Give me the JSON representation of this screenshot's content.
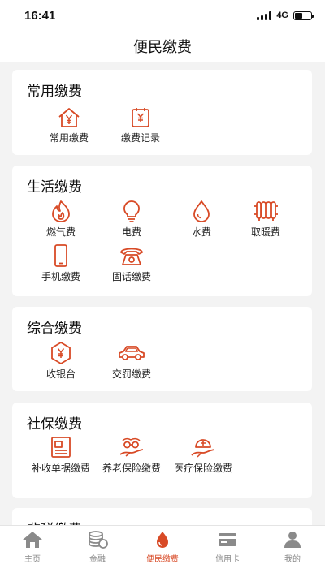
{
  "status_bar": {
    "time": "16:41",
    "network": "4G"
  },
  "header": {
    "title": "便民缴费"
  },
  "sections": [
    {
      "title": "常用缴费",
      "items": [
        {
          "label": "常用缴费",
          "icon": "house-yen-icon"
        },
        {
          "label": "缴费记录",
          "icon": "bill-record-icon"
        }
      ]
    },
    {
      "title": "生活缴费",
      "items": [
        {
          "label": "燃气费",
          "icon": "flame-icon"
        },
        {
          "label": "电费",
          "icon": "light-bulb-icon"
        },
        {
          "label": "水费",
          "icon": "water-drop-icon"
        },
        {
          "label": "取暖费",
          "icon": "radiator-icon"
        },
        {
          "label": "手机缴费",
          "icon": "mobile-phone-icon"
        },
        {
          "label": "固话缴费",
          "icon": "telephone-icon"
        }
      ]
    },
    {
      "title": "综合缴费",
      "items": [
        {
          "label": "收银台",
          "icon": "cashier-yen-icon"
        },
        {
          "label": "交罚缴费",
          "icon": "car-icon"
        }
      ]
    },
    {
      "title": "社保缴费",
      "items": [
        {
          "label": "补收单据缴费",
          "icon": "document-form-icon"
        },
        {
          "label": "养老保险缴费",
          "icon": "elderly-care-icon"
        },
        {
          "label": "医疗保险缴费",
          "icon": "medical-care-icon"
        }
      ]
    },
    {
      "title": "非税缴费",
      "items": []
    }
  ],
  "tab_bar": [
    {
      "label": "主页",
      "icon": "home-icon",
      "active": false
    },
    {
      "label": "金融",
      "icon": "coins-icon",
      "active": false
    },
    {
      "label": "便民缴费",
      "icon": "drop-icon",
      "active": true
    },
    {
      "label": "信用卡",
      "icon": "credit-card-icon",
      "active": false
    },
    {
      "label": "我的",
      "icon": "user-icon",
      "active": false
    }
  ],
  "colors": {
    "accent": "#d84a26",
    "background": "#f3f3f3",
    "card": "#ffffff",
    "tab_inactive": "#8a8a8a"
  }
}
